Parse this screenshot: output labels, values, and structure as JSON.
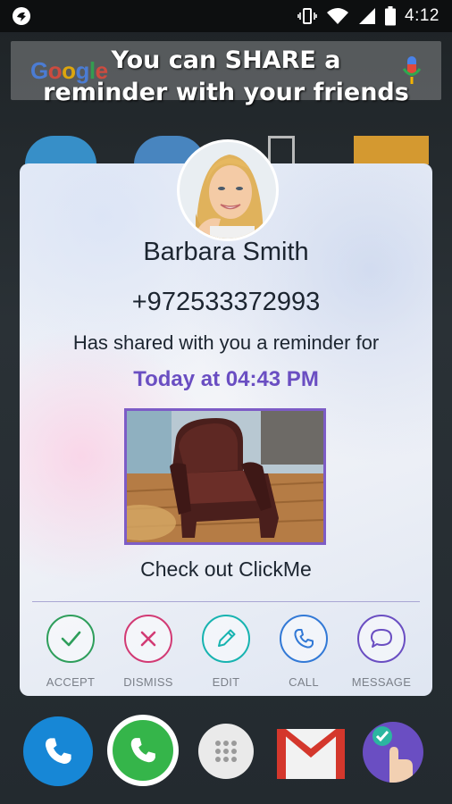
{
  "status_bar": {
    "time": "4:12",
    "icons": [
      "app-notification-icon",
      "vibrate-icon",
      "wifi-icon",
      "cell-signal-icon",
      "battery-icon"
    ]
  },
  "search_bar": {
    "logo": "Google",
    "icon": "mic-icon"
  },
  "promo_text": {
    "line1": "You can SHARE a",
    "line2": "reminder with your friends"
  },
  "card": {
    "contact_name": "Barbara Smith",
    "phone": "+972533372993",
    "shared_text": "Has shared with you a reminder for",
    "reminder_time": "Today at 04:43 PM",
    "caption": "Check out ClickMe",
    "actions": [
      {
        "label": "ACCEPT",
        "icon": "check-icon",
        "color": "#2e9e5b"
      },
      {
        "label": "DISMISS",
        "icon": "close-icon",
        "color": "#d23a74"
      },
      {
        "label": "EDIT",
        "icon": "pencil-icon",
        "color": "#17b3b0"
      },
      {
        "label": "CALL",
        "icon": "phone-icon",
        "color": "#3279d6"
      },
      {
        "label": "MESSAGE",
        "icon": "chat-bubble-icon",
        "color": "#6a4ec2"
      }
    ]
  },
  "dock": {
    "items": [
      "phone-app-icon",
      "whatsapp-icon",
      "app-drawer-icon",
      "gmail-icon",
      "clickme-app-icon"
    ]
  },
  "colors": {
    "accent": "#6a4ec2",
    "status_bar": "#0d0f10"
  }
}
